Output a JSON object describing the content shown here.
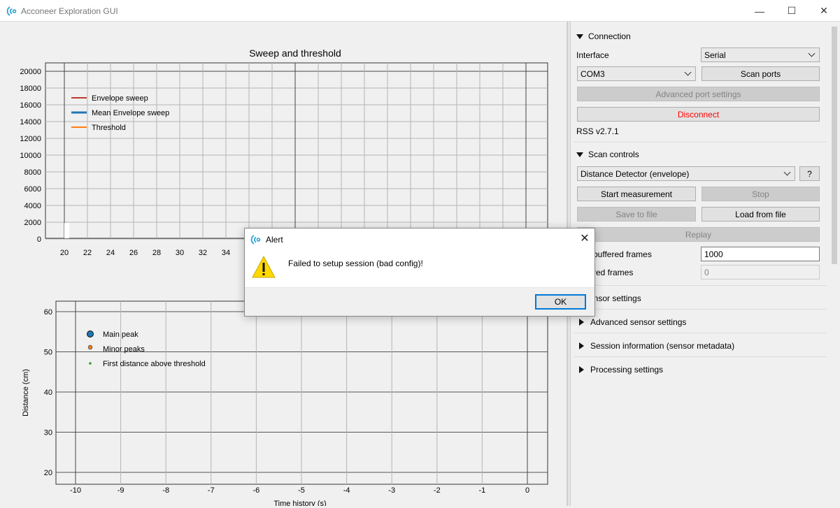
{
  "window": {
    "title": "Acconeer Exploration GUI",
    "min_glyph": "—",
    "max_glyph": "☐",
    "close_glyph": "✕"
  },
  "plot_top": {
    "title": "Sweep and threshold",
    "y_ticks": [
      "20000",
      "18000",
      "16000",
      "14000",
      "12000",
      "10000",
      "8000",
      "6000",
      "4000",
      "2000",
      "0"
    ],
    "x_ticks": [
      "20",
      "22",
      "24",
      "26",
      "28",
      "30",
      "32",
      "34"
    ],
    "legend": [
      {
        "label": "Envelope sweep",
        "color": "#c0392b"
      },
      {
        "label": "Mean Envelope sweep",
        "color": "#1f77b4"
      },
      {
        "label": "Threshold",
        "color": "#ff7f0e"
      }
    ]
  },
  "plot_bottom": {
    "ylabel": "Distance (cm)",
    "xlabel": "Time history (s)",
    "y_ticks": [
      "60",
      "50",
      "40",
      "30",
      "20"
    ],
    "x_ticks": [
      "-10",
      "-9",
      "-8",
      "-7",
      "-6",
      "-5",
      "-4",
      "-3",
      "-2",
      "-1",
      "0"
    ],
    "legend": [
      {
        "label": "Main peak",
        "color": "#1f77b4"
      },
      {
        "label": "Minor peaks",
        "color": "#ff7f0e"
      },
      {
        "label": "First distance above threshold",
        "color": "#2ca02c"
      }
    ]
  },
  "panel": {
    "connection": {
      "header": "Connection",
      "interface_label": "Interface",
      "interface_value": "Serial",
      "port_value": "COM3",
      "scan_ports": "Scan ports",
      "advanced_port_settings": "Advanced port settings",
      "disconnect": "Disconnect",
      "rss_version": "RSS v2.7.1"
    },
    "scan_controls": {
      "header": "Scan controls",
      "detector_value": "Distance Detector (envelope)",
      "help": "?",
      "start": "Start measurement",
      "stop": "Stop",
      "save": "Save to file",
      "load": "Load from file",
      "replay": "Replay",
      "max_buffered_label": "buffered frames",
      "max_buffered_value": "1000",
      "buffered_label": "red frames",
      "buffered_value": "0"
    },
    "sections": {
      "sensor_settings": "ensor settings",
      "advanced_sensor_settings": "Advanced sensor settings",
      "session_information": "Session information (sensor metadata)",
      "processing_settings": "Processing settings"
    }
  },
  "dialog": {
    "title": "Alert",
    "message": "Failed to setup session (bad config)!",
    "ok": "OK",
    "close_glyph": "✕"
  },
  "colors": {
    "accent": "#0078d7",
    "disconnect": "#ff0000"
  }
}
